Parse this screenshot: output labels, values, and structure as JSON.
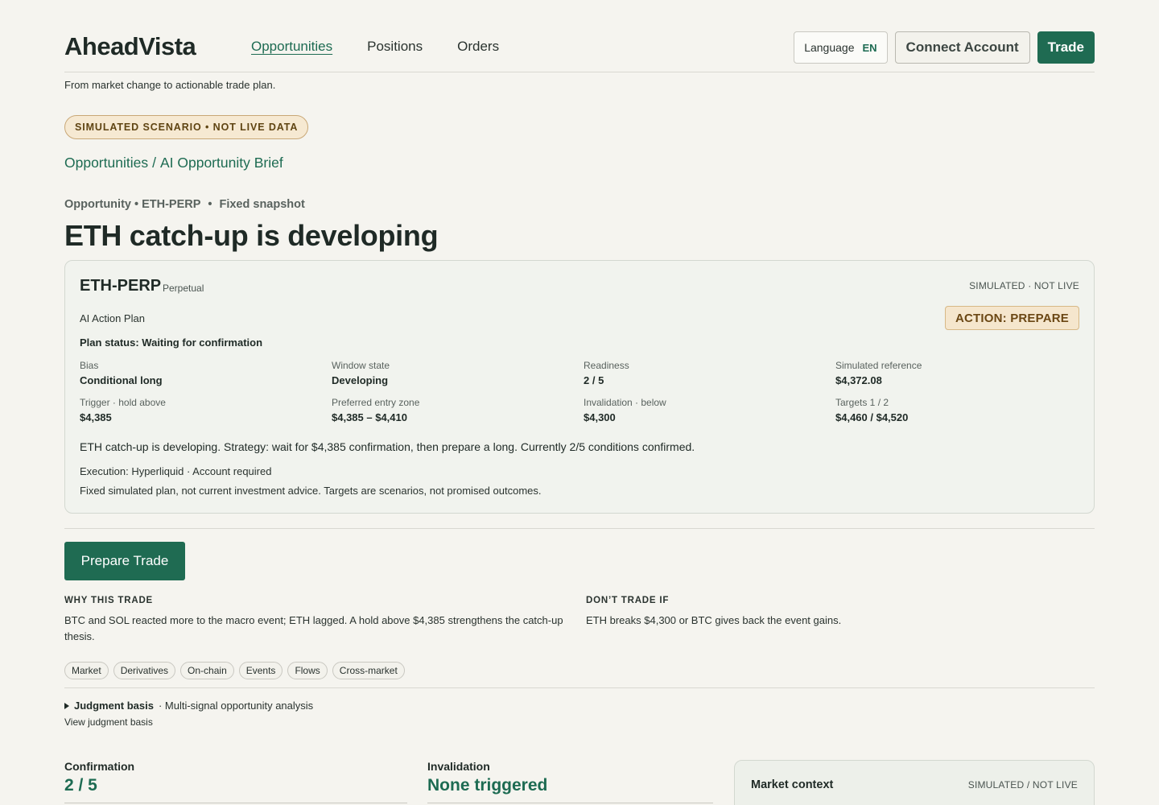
{
  "header": {
    "logo": "AheadVista",
    "nav": [
      "Opportunities",
      "Positions",
      "Orders"
    ],
    "language_label": "Language",
    "language_code": "EN",
    "connect_label": "Connect Account",
    "trade_label": "Trade"
  },
  "tagline": "From market change to actionable trade plan.",
  "sim_badge": "SIMULATED SCENARIO • NOT LIVE DATA",
  "breadcrumb": {
    "root": "Opportunities",
    "sep": "/",
    "current": "AI Opportunity Brief"
  },
  "meta": {
    "left": "Opportunity • ETH-PERP",
    "dot": "•",
    "right": "Fixed snapshot"
  },
  "title": "ETH catch-up is developing",
  "plan": {
    "symbol": "ETH-PERP",
    "symbol_type": "Perpetual",
    "sim_label": "SIMULATED · NOT LIVE",
    "action": "ACTION: PREPARE",
    "plan_label": "AI Action Plan",
    "plan_status": "Plan status: Waiting for confirmation",
    "fields": [
      {
        "label": "Bias",
        "value": "Conditional long"
      },
      {
        "label": "Window state",
        "value": "Developing"
      },
      {
        "label": "Readiness",
        "value": "2 / 5"
      },
      {
        "label": "Simulated reference",
        "value": "$4,372.08"
      },
      {
        "label": "Trigger · hold above",
        "value": "$4,385"
      },
      {
        "label": "Preferred entry zone",
        "value": "$4,385 – $4,410"
      },
      {
        "label": "Invalidation · below",
        "value": "$4,300"
      },
      {
        "label": "Targets 1 / 2",
        "value": "$4,460 / $4,520"
      }
    ],
    "summary": "ETH catch-up is developing. Strategy: wait for $4,385 confirmation, then prepare a long. Currently 2/5 conditions confirmed.",
    "execution": "Execution: Hyperliquid · Account required",
    "disclaimer": "Fixed simulated plan, not current investment advice. Targets are scenarios, not promised outcomes."
  },
  "prepare_label": "Prepare Trade",
  "why": {
    "heading": "WHY THIS TRADE",
    "line1": "BTC and SOL reacted more to the macro event; ETH lagged. A hold above $4,385 strengthens the catch-up",
    "line2": "thesis."
  },
  "dont": {
    "heading": "DON’T TRADE IF",
    "text": "ETH breaks $4,300 or BTC gives back the event gains."
  },
  "chips": [
    "Market",
    "Derivatives",
    "On-chain",
    "Events",
    "Flows",
    "Cross-market"
  ],
  "judgment": {
    "title": "Judgment basis",
    "desc": "· Multi-signal opportunity analysis",
    "link": "View judgment basis"
  },
  "stats": {
    "confirmation_label": "Confirmation",
    "confirmation_value": "2 / 5",
    "invalidation_label": "Invalidation",
    "invalidation_value": "None triggered"
  },
  "market_context": {
    "title": "Market context",
    "sim": "SIMULATED / NOT LIVE"
  },
  "colors": {
    "accent": "#1f6b52",
    "background": "#f5f4ef",
    "action_bg": "#f5e6cd"
  }
}
